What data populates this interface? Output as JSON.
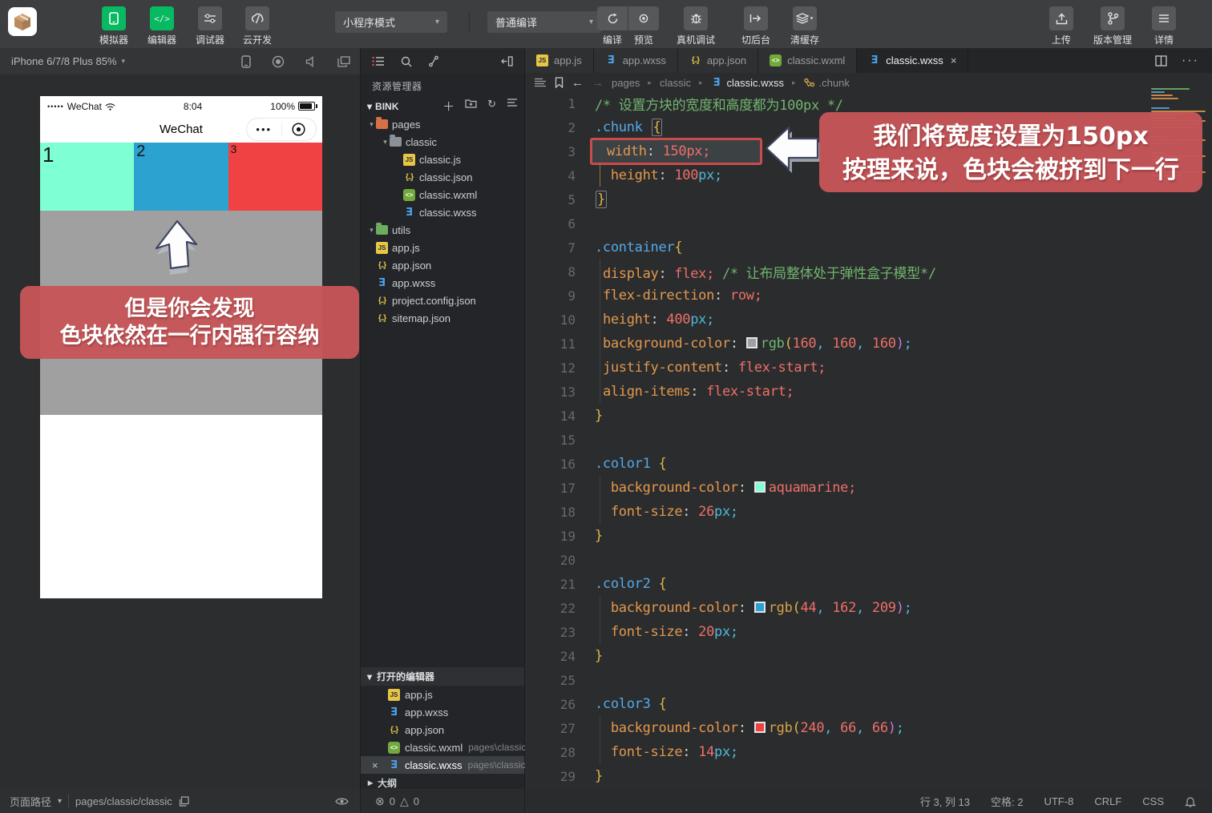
{
  "toolbar": {
    "left_buttons": [
      {
        "label": "模拟器",
        "active": true
      },
      {
        "label": "编辑器",
        "active": true
      },
      {
        "label": "调试器",
        "active": false
      },
      {
        "label": "云开发",
        "active": false
      }
    ],
    "mode_dropdown": "小程序模式",
    "compile_dropdown": "普通编译",
    "action_buttons": [
      "编译",
      "预览",
      "真机调试",
      "切后台",
      "清缓存"
    ],
    "right_buttons": [
      "上传",
      "版本管理",
      "详情"
    ]
  },
  "simulator": {
    "device": "iPhone 6/7/8 Plus 85%",
    "statusbar": {
      "signal_dots": "•••••",
      "carrier": "WeChat",
      "time": "8:04",
      "battery": "100%"
    },
    "nav_title": "WeChat",
    "capsule_dots": "•••",
    "container_color": "#a0a0a0",
    "blocks": [
      {
        "label": "1",
        "color": "#7fffd4",
        "font_px": 26
      },
      {
        "label": "2",
        "color": "#2ca2d1",
        "font_px": 20
      },
      {
        "label": "3",
        "color": "#f04242",
        "font_px": 14
      }
    ],
    "annotation": {
      "line1": "但是你会发现",
      "line2": "色块依然在一行内强行容纳"
    }
  },
  "explorer": {
    "title": "资源管理器",
    "project": "BINK",
    "tree": [
      {
        "label": "pages",
        "depth": 1,
        "kind": "folder",
        "color": "#d87045",
        "arrow": "▾"
      },
      {
        "label": "classic",
        "depth": 2,
        "kind": "folder",
        "color": "#8a9199",
        "arrow": "▾"
      },
      {
        "label": "classic.js",
        "depth": 3,
        "kind": "js"
      },
      {
        "label": "classic.json",
        "depth": 3,
        "kind": "json"
      },
      {
        "label": "classic.wxml",
        "depth": 3,
        "kind": "wxml"
      },
      {
        "label": "classic.wxss",
        "depth": 3,
        "kind": "wxss"
      },
      {
        "label": "utils",
        "depth": 1,
        "kind": "folder",
        "color": "#6cad5e",
        "arrow": "▾"
      },
      {
        "label": "app.js",
        "depth": 1,
        "kind": "js"
      },
      {
        "label": "app.json",
        "depth": 1,
        "kind": "json"
      },
      {
        "label": "app.wxss",
        "depth": 1,
        "kind": "wxss"
      },
      {
        "label": "project.config.json",
        "depth": 1,
        "kind": "json"
      },
      {
        "label": "sitemap.json",
        "depth": 1,
        "kind": "json"
      }
    ],
    "open_editors": {
      "title": "打开的编辑器",
      "items": [
        {
          "label": "app.js",
          "kind": "js"
        },
        {
          "label": "app.wxss",
          "kind": "wxss"
        },
        {
          "label": "app.json",
          "kind": "json"
        },
        {
          "label": "classic.wxml",
          "kind": "wxml",
          "path": "pages\\classic"
        },
        {
          "label": "classic.wxss",
          "kind": "wxss",
          "path": "pages\\classic",
          "active": true
        }
      ]
    },
    "outline": "大纲"
  },
  "editor": {
    "tabs": [
      {
        "label": "app.js",
        "kind": "js"
      },
      {
        "label": "app.wxss",
        "kind": "wxss"
      },
      {
        "label": "app.json",
        "kind": "json"
      },
      {
        "label": "classic.wxml",
        "kind": "wxml"
      },
      {
        "label": "classic.wxss",
        "kind": "wxss",
        "active": true,
        "closable": true
      }
    ],
    "breadcrumb": [
      "pages",
      "classic",
      "classic.wxss",
      ".chunk"
    ],
    "annotation": {
      "line1": "我们将宽度设置为150px",
      "line2": "按理来说，色块会被挤到下一行"
    },
    "code": [
      {
        "n": 1,
        "t": [
          [
            "c",
            "/* 设置方块的宽度和高度都为100px */"
          ]
        ]
      },
      {
        "n": 2,
        "t": [
          [
            "s",
            ".chunk"
          ],
          [
            "w",
            " "
          ],
          [
            "bx",
            "{"
          ]
        ]
      },
      {
        "n": 3,
        "hl": true,
        "t": [
          [
            "p",
            "width"
          ],
          [
            "w",
            ": "
          ],
          [
            "v",
            "150px;"
          ]
        ]
      },
      {
        "n": 4,
        "g": "y",
        "t": [
          [
            "w",
            "  "
          ],
          [
            "p",
            "height"
          ],
          [
            "w",
            ": "
          ],
          [
            "v",
            "100"
          ],
          [
            "u",
            "px;"
          ]
        ]
      },
      {
        "n": 5,
        "t": [
          [
            "bx",
            "}"
          ]
        ]
      },
      {
        "n": 6,
        "t": []
      },
      {
        "n": 7,
        "t": [
          [
            "s",
            ".container"
          ],
          [
            "b",
            "{"
          ]
        ]
      },
      {
        "n": 8,
        "g": "gr",
        "t": [
          [
            "w",
            " "
          ],
          [
            "p",
            "display"
          ],
          [
            "w",
            ": "
          ],
          [
            "v",
            "flex;"
          ],
          [
            "c",
            " /* 让布局整体处于弹性盒子模型*/"
          ]
        ]
      },
      {
        "n": 9,
        "g": "gr",
        "t": [
          [
            "w",
            " "
          ],
          [
            "p",
            "flex-direction"
          ],
          [
            "w",
            ": "
          ],
          [
            "v",
            "row;"
          ]
        ]
      },
      {
        "n": 10,
        "g": "gr",
        "t": [
          [
            "w",
            " "
          ],
          [
            "p",
            "height"
          ],
          [
            "w",
            ": "
          ],
          [
            "v",
            "400"
          ],
          [
            "u",
            "px;"
          ]
        ]
      },
      {
        "n": 11,
        "g": "gr",
        "t": [
          [
            "w",
            " "
          ],
          [
            "p",
            "background-color"
          ],
          [
            "w",
            ": "
          ],
          [
            "sw",
            "#a0a0a0"
          ],
          [
            "g",
            "rgb"
          ],
          [
            "b",
            "("
          ],
          [
            "v",
            "160"
          ],
          [
            "m",
            ", "
          ],
          [
            "v",
            "160"
          ],
          [
            "m",
            ", "
          ],
          [
            "v",
            "160"
          ],
          [
            "q",
            ")"
          ],
          [
            "u",
            ";"
          ]
        ]
      },
      {
        "n": 12,
        "g": "gr",
        "t": [
          [
            "w",
            " "
          ],
          [
            "p",
            "justify-content"
          ],
          [
            "w",
            ": "
          ],
          [
            "v",
            "flex-start;"
          ]
        ]
      },
      {
        "n": 13,
        "g": "gr",
        "t": [
          [
            "w",
            " "
          ],
          [
            "p",
            "align-items"
          ],
          [
            "w",
            ": "
          ],
          [
            "v",
            "flex-start;"
          ]
        ]
      },
      {
        "n": 14,
        "t": [
          [
            "b",
            "}"
          ]
        ]
      },
      {
        "n": 15,
        "t": []
      },
      {
        "n": 16,
        "t": [
          [
            "s",
            ".color1"
          ],
          [
            "w",
            " "
          ],
          [
            "b",
            "{"
          ]
        ]
      },
      {
        "n": 17,
        "g": "gr",
        "t": [
          [
            "w",
            "  "
          ],
          [
            "p",
            "background-color"
          ],
          [
            "w",
            ": "
          ],
          [
            "sw",
            "#7fffd4"
          ],
          [
            "v",
            "aquamarine;"
          ]
        ]
      },
      {
        "n": 18,
        "g": "gr",
        "t": [
          [
            "w",
            "  "
          ],
          [
            "p",
            "font-size"
          ],
          [
            "w",
            ": "
          ],
          [
            "v",
            "26"
          ],
          [
            "u",
            "px;"
          ]
        ]
      },
      {
        "n": 19,
        "t": [
          [
            "b",
            "}"
          ]
        ]
      },
      {
        "n": 20,
        "t": []
      },
      {
        "n": 21,
        "t": [
          [
            "s",
            ".color2"
          ],
          [
            "w",
            " "
          ],
          [
            "b",
            "{"
          ]
        ]
      },
      {
        "n": 22,
        "g": "gr",
        "t": [
          [
            "w",
            "  "
          ],
          [
            "p",
            "background-color"
          ],
          [
            "w",
            ": "
          ],
          [
            "sw",
            "#2ca2d1"
          ],
          [
            "f",
            "rgb"
          ],
          [
            "b",
            "("
          ],
          [
            "v",
            "44"
          ],
          [
            "m",
            ", "
          ],
          [
            "v",
            "162"
          ],
          [
            "m",
            ", "
          ],
          [
            "v",
            "209"
          ],
          [
            "q",
            ")"
          ],
          [
            "u",
            ";"
          ]
        ]
      },
      {
        "n": 23,
        "g": "gr",
        "t": [
          [
            "w",
            "  "
          ],
          [
            "p",
            "font-size"
          ],
          [
            "w",
            ": "
          ],
          [
            "v",
            "20"
          ],
          [
            "u",
            "px;"
          ]
        ]
      },
      {
        "n": 24,
        "t": [
          [
            "b",
            "}"
          ]
        ]
      },
      {
        "n": 25,
        "t": []
      },
      {
        "n": 26,
        "t": [
          [
            "s",
            ".color3"
          ],
          [
            "w",
            " "
          ],
          [
            "b",
            "{"
          ]
        ]
      },
      {
        "n": 27,
        "g": "gr",
        "t": [
          [
            "w",
            "  "
          ],
          [
            "p",
            "background-color"
          ],
          [
            "w",
            ": "
          ],
          [
            "sw",
            "#f04242"
          ],
          [
            "f",
            "rgb"
          ],
          [
            "b",
            "("
          ],
          [
            "v",
            "240"
          ],
          [
            "m",
            ", "
          ],
          [
            "v",
            "66"
          ],
          [
            "m",
            ", "
          ],
          [
            "v",
            "66"
          ],
          [
            "q",
            ")"
          ],
          [
            "u",
            ";"
          ]
        ]
      },
      {
        "n": 28,
        "g": "gr",
        "t": [
          [
            "w",
            "  "
          ],
          [
            "p",
            "font-size"
          ],
          [
            "w",
            ": "
          ],
          [
            "v",
            "14"
          ],
          [
            "u",
            "px;"
          ]
        ]
      },
      {
        "n": 29,
        "t": [
          [
            "b",
            "}"
          ]
        ]
      }
    ]
  },
  "statusbar": {
    "page_path_label": "页面路径",
    "page_path": "pages/classic/classic",
    "problems": {
      "errors": "0",
      "warnings": "0",
      "error_sym": "⊗",
      "warn_sym": "△"
    },
    "cursor": "行 3, 列 13",
    "indent": "空格: 2",
    "encoding": "UTF-8",
    "eol": "CRLF",
    "lang": "CSS"
  }
}
